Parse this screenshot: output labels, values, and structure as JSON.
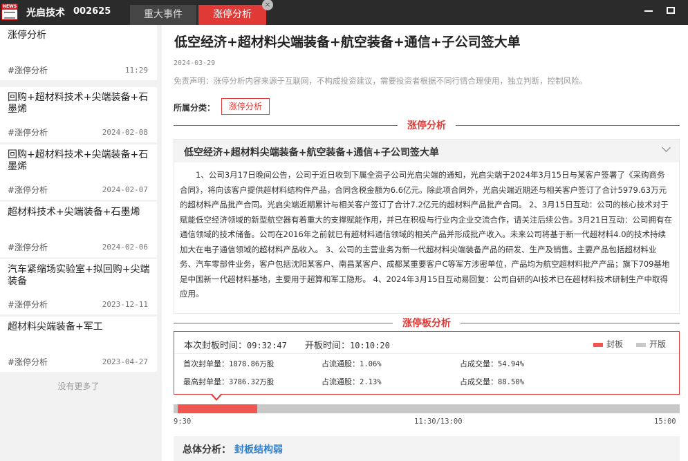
{
  "titlebar": {
    "logo_text": "NEWS",
    "stock_name": "光启技术",
    "stock_code": "002625",
    "tabs": [
      {
        "label": "重大事件",
        "active": false
      },
      {
        "label": "涨停分析",
        "active": true
      }
    ],
    "close_glyph": "×"
  },
  "sidebar": {
    "items": [
      {
        "title": "涨停分析",
        "tag": "#涨停分析",
        "date": "11:29"
      },
      {
        "title": "回购+超材料技术+尖端装备+石墨烯",
        "tag": "#涨停分析",
        "date": "2024-02-08"
      },
      {
        "title": "回购+超材料技术+尖端装备+石墨烯",
        "tag": "#涨停分析",
        "date": "2024-02-07"
      },
      {
        "title": "超材料技术+尖端装备+石墨烯",
        "tag": "#涨停分析",
        "date": "2024-02-06"
      },
      {
        "title": "汽车紧缩场实验室+拟回购+尖端装备",
        "tag": "#涨停分析",
        "date": "2023-12-11"
      },
      {
        "title": "超材料尖端装备+军工",
        "tag": "#涨停分析",
        "date": "2023-04-27"
      }
    ],
    "no_more": "没有更多了"
  },
  "article": {
    "title": "低空经济+超材料尖端装备+航空装备+通信+子公司签大单",
    "date": "2024-03-29",
    "disclaimer": "免责声明：涨停分析内容来源于互联网，不构成投资建议，需要投资者根据不同行情合理使用，独立判断，控制风险。",
    "category_label": "所属分类：",
    "category": "涨停分析",
    "section_title": "涨停分析",
    "analysis_title": "低空经济+超材料尖端装备+航空装备+通信+子公司签大单",
    "analysis_body": "1、公司3月17日晚间公告，公司于近日收到下属全资子公司光启尖端的通知，光启尖端于2024年3月15日与某客户签署了《采购商务合同》，将向该客户提供超材料结构件产品，合同含税金额为6.6亿元。除此项合同外，光启尖端近期还与相关客户签订了合计5979.63万元的超材料产品批产合同。光启尖端近期累计与相关客户签订了合计7.2亿元的超材料产品批产合同。 2、3月15日互动：公司的核心技术对于赋能低空经济领域的新型航空器有着重大的支撑赋能作用，并已在积极与行业内企业交流合作，请关注后续公告。3月21日互动：公司拥有在通信领域的技术储备。公司在2016年之前就已有超材料通信领域的相关产品并形成批产收入。未来公司将基于新一代超材料4.0的技术持续加大在电子通信领域的超材料产品收入。 3、公司的主营业务为新一代超材料尖端装备产品的研发、生产及销售。主要产品包括超材料业务、汽车零部件业务，客户包括沈阳某客户、南昌某客户、成都某重要客户C等军方涉密单位，产品均为航空超材料批产产品；旗下709基地是中国新一代超材料基地，主要用于超算和军工隐形。 4、2024年3月15日互动易回复：公司自研的AI技术已在超材料技术研制生产中取得应用。"
  },
  "board": {
    "section_title": "涨停板分析",
    "seal_time_label": "本次封板时间：",
    "seal_time": "09:32:47",
    "open_time_label": "开板时间：",
    "open_time": "10:10:20",
    "legend": {
      "seal": "封板",
      "open": "开版",
      "seal_color": "#f05550",
      "open_color": "#c8c8c8"
    },
    "stats": [
      {
        "label": "首次封单量：",
        "value": "1878.86万股"
      },
      {
        "label": "占流通股：",
        "value": "1.06%"
      },
      {
        "label": "占成交量：",
        "value": "54.94%"
      },
      {
        "label": "最高封单量：",
        "value": "3786.32万股"
      },
      {
        "label": "占流通股：",
        "value": "2.13%"
      },
      {
        "label": "占成交量：",
        "value": "88.50%"
      }
    ],
    "timeline": {
      "start_label": "9:30",
      "mid_label": "11:30/13:00",
      "end_label": "15:00",
      "sealed_start": 0.0083,
      "sealed_end": 0.165
    }
  },
  "summary": {
    "label": "总体分析：",
    "value": "封板结构弱"
  }
}
